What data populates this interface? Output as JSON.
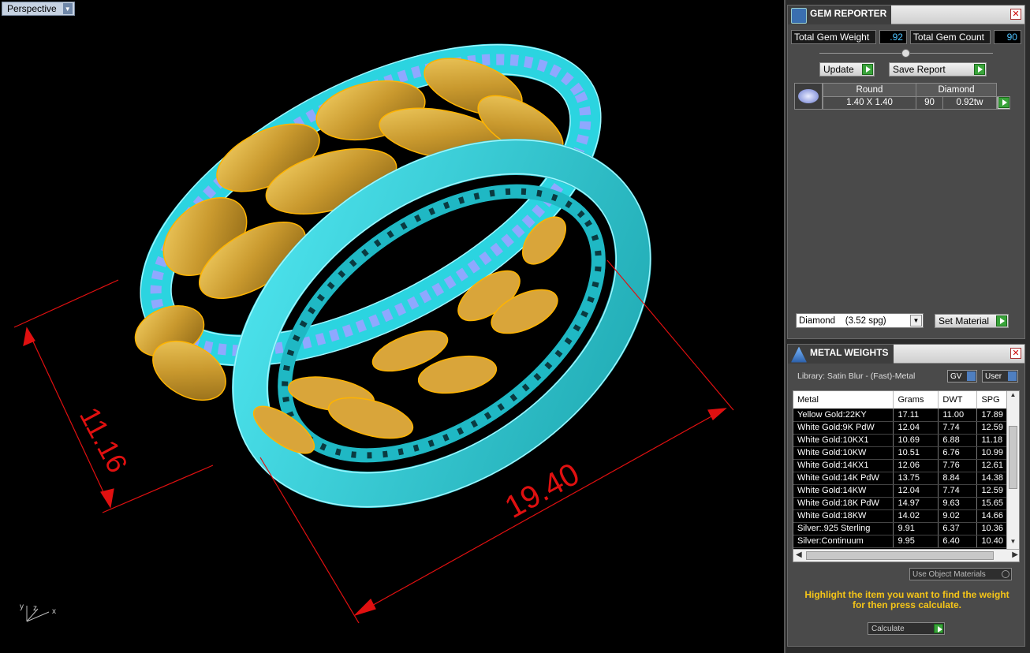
{
  "viewport": {
    "label": "Perspective",
    "dim_height": "11.16",
    "dim_length": "19.40",
    "axis_y": "y",
    "axis_z": "z",
    "axis_x": "x"
  },
  "gem_reporter": {
    "title": "GEM REPORTER",
    "total_weight_label": "Total Gem Weight",
    "total_weight_value": ".92",
    "total_count_label": "Total Gem Count",
    "total_count_value": "90",
    "update_label": "Update",
    "save_label": "Save Report",
    "table": {
      "shape": "Round",
      "material": "Diamond",
      "size": "1.40 X 1.40",
      "count": "90",
      "weight": "0.92tw"
    },
    "material_select": "Diamond    (3.52 spg)",
    "set_material_label": "Set Material"
  },
  "metal_weights": {
    "title": "METAL WEIGHTS",
    "library": "Library: Satin Blur - (Fast)-Metal",
    "gv_label": "GV",
    "user_label": "User",
    "columns": [
      "Metal",
      "Grams",
      "DWT",
      "SPG"
    ],
    "rows": [
      [
        "Yellow Gold:22KY",
        "17.11",
        "11.00",
        "17.89"
      ],
      [
        "White Gold:9K PdW",
        "12.04",
        "7.74",
        "12.59"
      ],
      [
        "White Gold:10KX1",
        "10.69",
        "6.88",
        "11.18"
      ],
      [
        "White Gold:10KW",
        "10.51",
        "6.76",
        "10.99"
      ],
      [
        "White Gold:14KX1",
        "12.06",
        "7.76",
        "12.61"
      ],
      [
        "White Gold:14K PdW",
        "13.75",
        "8.84",
        "14.38"
      ],
      [
        "White Gold:14KW",
        "12.04",
        "7.74",
        "12.59"
      ],
      [
        "White Gold:18K PdW",
        "14.97",
        "9.63",
        "15.65"
      ],
      [
        "White Gold:18KW",
        "14.02",
        "9.02",
        "14.66"
      ],
      [
        "Silver:.925 Sterling",
        "9.91",
        "6.37",
        "10.36"
      ],
      [
        "Silver:Continuum",
        "9.95",
        "6.40",
        "10.40"
      ]
    ],
    "use_object_label": "Use Object Materials",
    "hint": "Highlight the item you want to find the weight for then press calculate.",
    "calculate_label": "Calculate"
  }
}
